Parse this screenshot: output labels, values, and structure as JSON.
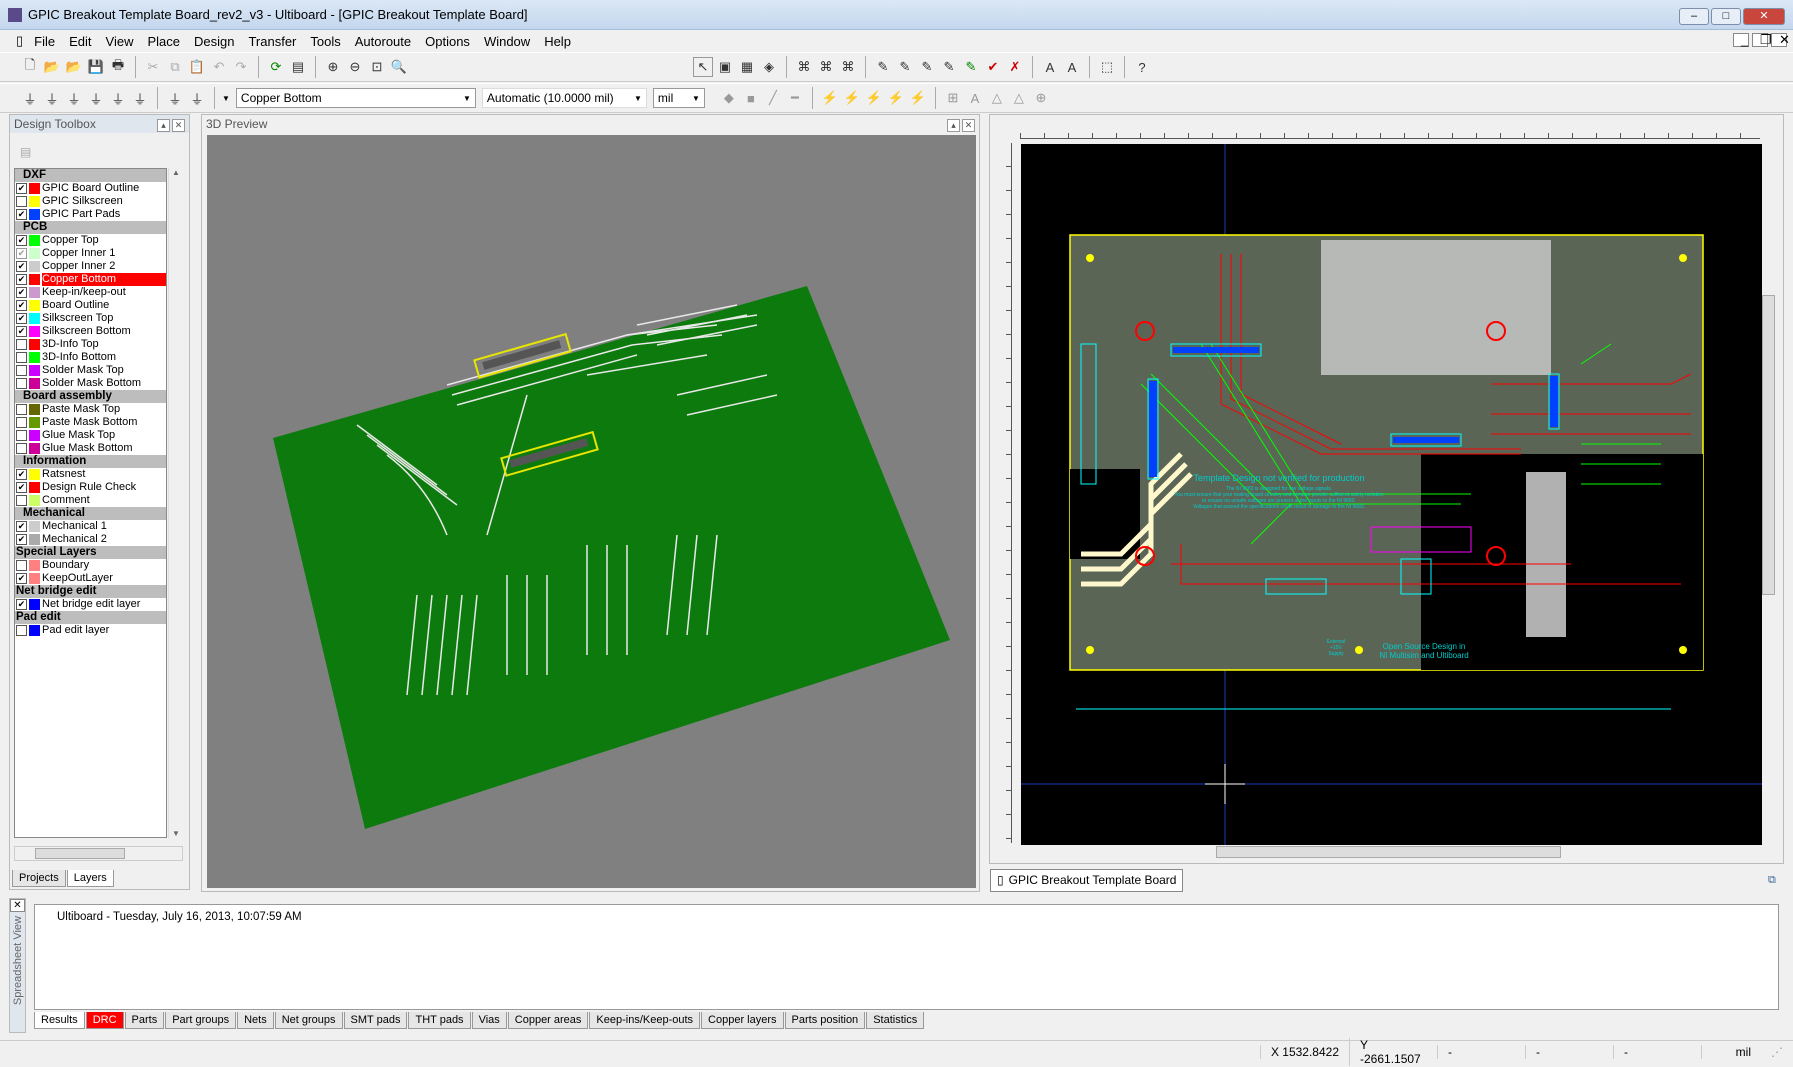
{
  "window": {
    "title": "GPIC Breakout Template Board_rev2_v3 - Ultiboard - [GPIC Breakout Template Board]",
    "minimize": "–",
    "maximize": "□",
    "close": "✕"
  },
  "menu": [
    "File",
    "Edit",
    "View",
    "Place",
    "Design",
    "Transfer",
    "Tools",
    "Autoroute",
    "Options",
    "Window",
    "Help"
  ],
  "toolbar2": {
    "layer_select": "Copper Bottom",
    "grid_select": "Automatic (10.0000 mil)",
    "unit_select": "mil"
  },
  "design_toolbox": {
    "title": "Design Toolbox",
    "groups": [
      {
        "name": "DXF",
        "layers": [
          {
            "label": "GPIC Board Outline",
            "checked": true,
            "color": "#ff0000"
          },
          {
            "label": "GPIC Silkscreen",
            "checked": false,
            "color": "#ffff00"
          },
          {
            "label": "GPIC Part Pads",
            "checked": true,
            "color": "#0040ff"
          }
        ]
      },
      {
        "name": "PCB",
        "layers": [
          {
            "label": "Copper Top",
            "checked": true,
            "color": "#00ff00"
          },
          {
            "label": "Copper Inner 1",
            "checked": true,
            "disabled": true,
            "color": "#ccffcc"
          },
          {
            "label": "Copper Inner 2",
            "checked": true,
            "color": "#cccccc"
          },
          {
            "label": "Copper Bottom",
            "checked": true,
            "color": "#ff0000",
            "selected": true
          },
          {
            "label": "Keep-in/keep-out",
            "checked": true,
            "color": "#cc99cc"
          },
          {
            "label": "Board Outline",
            "checked": true,
            "color": "#ffff00"
          },
          {
            "label": "Silkscreen Top",
            "checked": true,
            "color": "#00ffff"
          },
          {
            "label": "Silkscreen Bottom",
            "checked": true,
            "color": "#ff00ff"
          },
          {
            "label": "3D-Info Top",
            "checked": false,
            "color": "#ff0000"
          },
          {
            "label": "3D-Info Bottom",
            "checked": false,
            "color": "#00ff00"
          },
          {
            "label": "Solder Mask Top",
            "checked": false,
            "color": "#cc00ff"
          },
          {
            "label": "Solder Mask Bottom",
            "checked": false,
            "color": "#cc0099"
          }
        ]
      },
      {
        "name": "Board assembly",
        "layers": [
          {
            "label": "Paste Mask Top",
            "checked": false,
            "color": "#666600"
          },
          {
            "label": "Paste Mask Bottom",
            "checked": false,
            "color": "#669900"
          },
          {
            "label": "Glue Mask Top",
            "checked": false,
            "color": "#cc00ff"
          },
          {
            "label": "Glue Mask Bottom",
            "checked": false,
            "color": "#cc0099"
          }
        ]
      },
      {
        "name": "Information",
        "layers": [
          {
            "label": "Ratsnest",
            "checked": true,
            "color": "#ffff00"
          },
          {
            "label": "Design Rule Check",
            "checked": true,
            "color": "#ff0000"
          },
          {
            "label": "Comment",
            "checked": false,
            "color": "#ccff66"
          }
        ]
      },
      {
        "name": "Mechanical",
        "layers": [
          {
            "label": "Mechanical 1",
            "checked": true,
            "color": "#cccccc"
          },
          {
            "label": "Mechanical 2",
            "checked": true,
            "color": "#aaaaaa"
          }
        ]
      },
      {
        "name": "Special Layers",
        "flush": true,
        "layers": [
          {
            "label": "Boundary",
            "checked": false,
            "color": "#ff8080"
          },
          {
            "label": "KeepOutLayer",
            "checked": true,
            "color": "#ff8080"
          }
        ]
      },
      {
        "name": "Net bridge edit",
        "flush": true,
        "layers": [
          {
            "label": "Net bridge edit layer",
            "checked": true,
            "color": "#0000ff"
          }
        ]
      },
      {
        "name": "Pad edit",
        "flush": true,
        "layers": [
          {
            "label": "Pad edit layer",
            "checked": false,
            "color": "#0000ff"
          }
        ]
      }
    ],
    "tabs": [
      "Projects",
      "Layers"
    ]
  },
  "preview3d": {
    "title": "3D Preview"
  },
  "pcb_view": {
    "tab": "GPIC Breakout Template Board",
    "texts": {
      "warning_title": "Template Design not verified for production",
      "warning_l1": "The NI 9683 is designed for low voltage signals.",
      "warning_l2": "You must ensure that your mating board circuitry and sensors provide sufficient safety isolation",
      "warning_l3": "to ensure no unsafe voltages are present at the inputs to the NI 9683.",
      "warning_l4": "Voltages that exceed the specifications could result in damage to the NI 9683.",
      "open_source_1": "Open Source Design in",
      "open_source_2": "NI Multisim and Ultiboard",
      "external_1": "External",
      "external_2": "+15V",
      "external_3": "Supply"
    }
  },
  "spreadsheet": {
    "side_label": "Spreadsheet View",
    "log": "Ultiboard  -  Tuesday, July 16, 2013, 10:07:59 AM",
    "tabs": [
      "Results",
      "DRC",
      "Parts",
      "Part groups",
      "Nets",
      "Net groups",
      "SMT pads",
      "THT pads",
      "Vias",
      "Copper areas",
      "Keep-ins/Keep-outs",
      "Copper layers",
      "Parts position",
      "Statistics"
    ],
    "active_tab": "Results",
    "error_tab": "DRC"
  },
  "status": {
    "x": "X 1532.8422",
    "y": "Y -2661.1507",
    "f1": "-",
    "f2": "-",
    "f3": "-",
    "unit": "mil"
  }
}
